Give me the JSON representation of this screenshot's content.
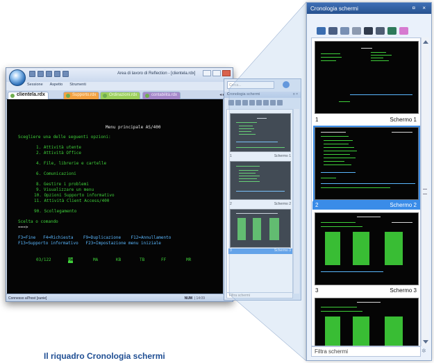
{
  "main_window": {
    "title": "Area di lavoro di Reflection - [clientela.rdx]",
    "menu": [
      "Sessione",
      "Aspetto",
      "Strumenti"
    ],
    "tabs": [
      {
        "label": "clientela.rdx",
        "state": "active"
      },
      {
        "label": "Supporto.rdx",
        "state": "orange"
      },
      {
        "label": "Ordinazioni.rdx",
        "state": "green"
      },
      {
        "label": "contabilità.rdx",
        "state": "purple"
      }
    ],
    "status_left": "Connesso all'host [sunie]",
    "status_right": "NUM",
    "status_time": "14:09"
  },
  "terminal": {
    "title": "Menu principale AS/400",
    "prompt": "Scegliere una delle seguenti opzioni:",
    "options": [
      "1. Attività utente",
      "2. Attività Office",
      "4. File, librerie e cartelle",
      "6. Comunicazioni",
      "8. Gestire i problemi",
      "9. Visualizzare un menu",
      "10. Opzioni Supporto informativo",
      "11. Attività Client Access/400",
      "90. Scollegamento"
    ],
    "command_label": "Scelta o comando",
    "command_prompt": "===>",
    "fkeys_1": "F3=Fine   F4=Richiesta    F9=Duplicazione    F12=Annullamento",
    "fkeys_2": "F13=Supporto informativo   F23=Impostazione menu iniziale",
    "bottom_row": [
      "03/122",
      "MW",
      "MA",
      "KB",
      "TB",
      "FF",
      "MR"
    ]
  },
  "mini_pane": {
    "search_placeholder": "Cerca...",
    "title": "Cronologia schermi",
    "items": [
      {
        "number": "1",
        "label": "Schermo 1"
      },
      {
        "number": "2",
        "label": "Schermo 2"
      },
      {
        "number": "3",
        "label": "Schermo 3"
      }
    ],
    "filter_placeholder": "Filtra schermi"
  },
  "history_pane": {
    "title": "Cronologia schermi",
    "header_controls": "¤ ×",
    "tool_icons": [
      "screen-capture-icon",
      "save-icon",
      "copy-screens-icon",
      "send-icon",
      "camera-icon",
      "document-icon",
      "recycle-icon",
      "eraser-icon"
    ],
    "items": [
      {
        "number": "1",
        "label": "Schermo 1",
        "selected": false
      },
      {
        "number": "2",
        "label": "Schermo 2",
        "selected": true
      },
      {
        "number": "3",
        "label": "Schermo 3",
        "selected": false
      }
    ],
    "filter_placeholder": "Filtra schermi"
  },
  "caption": "Il riquadro Cronologia schermi",
  "colors": {
    "terminal_green": "#3fd13a",
    "selection_blue": "#3a8ce8",
    "caption_blue": "#1f4e93",
    "pane_header": "#2f5e9f"
  }
}
